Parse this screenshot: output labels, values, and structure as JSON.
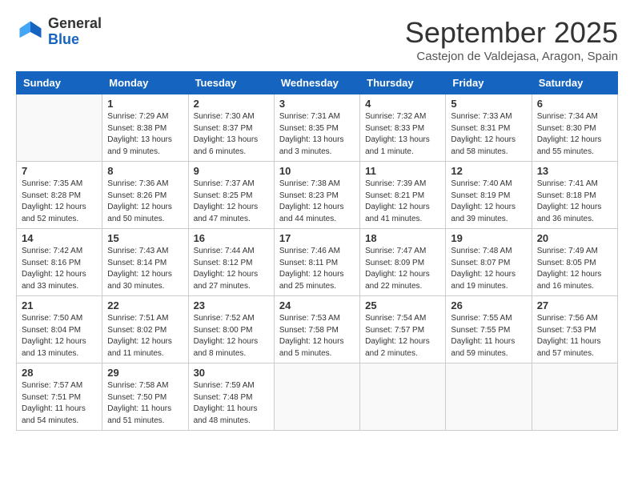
{
  "header": {
    "logo_general": "General",
    "logo_blue": "Blue",
    "month_title": "September 2025",
    "location": "Castejon de Valdejasa, Aragon, Spain"
  },
  "weekdays": [
    "Sunday",
    "Monday",
    "Tuesday",
    "Wednesday",
    "Thursday",
    "Friday",
    "Saturday"
  ],
  "weeks": [
    [
      {
        "day": "",
        "info": ""
      },
      {
        "day": "1",
        "info": "Sunrise: 7:29 AM\nSunset: 8:38 PM\nDaylight: 13 hours\nand 9 minutes."
      },
      {
        "day": "2",
        "info": "Sunrise: 7:30 AM\nSunset: 8:37 PM\nDaylight: 13 hours\nand 6 minutes."
      },
      {
        "day": "3",
        "info": "Sunrise: 7:31 AM\nSunset: 8:35 PM\nDaylight: 13 hours\nand 3 minutes."
      },
      {
        "day": "4",
        "info": "Sunrise: 7:32 AM\nSunset: 8:33 PM\nDaylight: 13 hours\nand 1 minute."
      },
      {
        "day": "5",
        "info": "Sunrise: 7:33 AM\nSunset: 8:31 PM\nDaylight: 12 hours\nand 58 minutes."
      },
      {
        "day": "6",
        "info": "Sunrise: 7:34 AM\nSunset: 8:30 PM\nDaylight: 12 hours\nand 55 minutes."
      }
    ],
    [
      {
        "day": "7",
        "info": "Sunrise: 7:35 AM\nSunset: 8:28 PM\nDaylight: 12 hours\nand 52 minutes."
      },
      {
        "day": "8",
        "info": "Sunrise: 7:36 AM\nSunset: 8:26 PM\nDaylight: 12 hours\nand 50 minutes."
      },
      {
        "day": "9",
        "info": "Sunrise: 7:37 AM\nSunset: 8:25 PM\nDaylight: 12 hours\nand 47 minutes."
      },
      {
        "day": "10",
        "info": "Sunrise: 7:38 AM\nSunset: 8:23 PM\nDaylight: 12 hours\nand 44 minutes."
      },
      {
        "day": "11",
        "info": "Sunrise: 7:39 AM\nSunset: 8:21 PM\nDaylight: 12 hours\nand 41 minutes."
      },
      {
        "day": "12",
        "info": "Sunrise: 7:40 AM\nSunset: 8:19 PM\nDaylight: 12 hours\nand 39 minutes."
      },
      {
        "day": "13",
        "info": "Sunrise: 7:41 AM\nSunset: 8:18 PM\nDaylight: 12 hours\nand 36 minutes."
      }
    ],
    [
      {
        "day": "14",
        "info": "Sunrise: 7:42 AM\nSunset: 8:16 PM\nDaylight: 12 hours\nand 33 minutes."
      },
      {
        "day": "15",
        "info": "Sunrise: 7:43 AM\nSunset: 8:14 PM\nDaylight: 12 hours\nand 30 minutes."
      },
      {
        "day": "16",
        "info": "Sunrise: 7:44 AM\nSunset: 8:12 PM\nDaylight: 12 hours\nand 27 minutes."
      },
      {
        "day": "17",
        "info": "Sunrise: 7:46 AM\nSunset: 8:11 PM\nDaylight: 12 hours\nand 25 minutes."
      },
      {
        "day": "18",
        "info": "Sunrise: 7:47 AM\nSunset: 8:09 PM\nDaylight: 12 hours\nand 22 minutes."
      },
      {
        "day": "19",
        "info": "Sunrise: 7:48 AM\nSunset: 8:07 PM\nDaylight: 12 hours\nand 19 minutes."
      },
      {
        "day": "20",
        "info": "Sunrise: 7:49 AM\nSunset: 8:05 PM\nDaylight: 12 hours\nand 16 minutes."
      }
    ],
    [
      {
        "day": "21",
        "info": "Sunrise: 7:50 AM\nSunset: 8:04 PM\nDaylight: 12 hours\nand 13 minutes."
      },
      {
        "day": "22",
        "info": "Sunrise: 7:51 AM\nSunset: 8:02 PM\nDaylight: 12 hours\nand 11 minutes."
      },
      {
        "day": "23",
        "info": "Sunrise: 7:52 AM\nSunset: 8:00 PM\nDaylight: 12 hours\nand 8 minutes."
      },
      {
        "day": "24",
        "info": "Sunrise: 7:53 AM\nSunset: 7:58 PM\nDaylight: 12 hours\nand 5 minutes."
      },
      {
        "day": "25",
        "info": "Sunrise: 7:54 AM\nSunset: 7:57 PM\nDaylight: 12 hours\nand 2 minutes."
      },
      {
        "day": "26",
        "info": "Sunrise: 7:55 AM\nSunset: 7:55 PM\nDaylight: 11 hours\nand 59 minutes."
      },
      {
        "day": "27",
        "info": "Sunrise: 7:56 AM\nSunset: 7:53 PM\nDaylight: 11 hours\nand 57 minutes."
      }
    ],
    [
      {
        "day": "28",
        "info": "Sunrise: 7:57 AM\nSunset: 7:51 PM\nDaylight: 11 hours\nand 54 minutes."
      },
      {
        "day": "29",
        "info": "Sunrise: 7:58 AM\nSunset: 7:50 PM\nDaylight: 11 hours\nand 51 minutes."
      },
      {
        "day": "30",
        "info": "Sunrise: 7:59 AM\nSunset: 7:48 PM\nDaylight: 11 hours\nand 48 minutes."
      },
      {
        "day": "",
        "info": ""
      },
      {
        "day": "",
        "info": ""
      },
      {
        "day": "",
        "info": ""
      },
      {
        "day": "",
        "info": ""
      }
    ]
  ]
}
